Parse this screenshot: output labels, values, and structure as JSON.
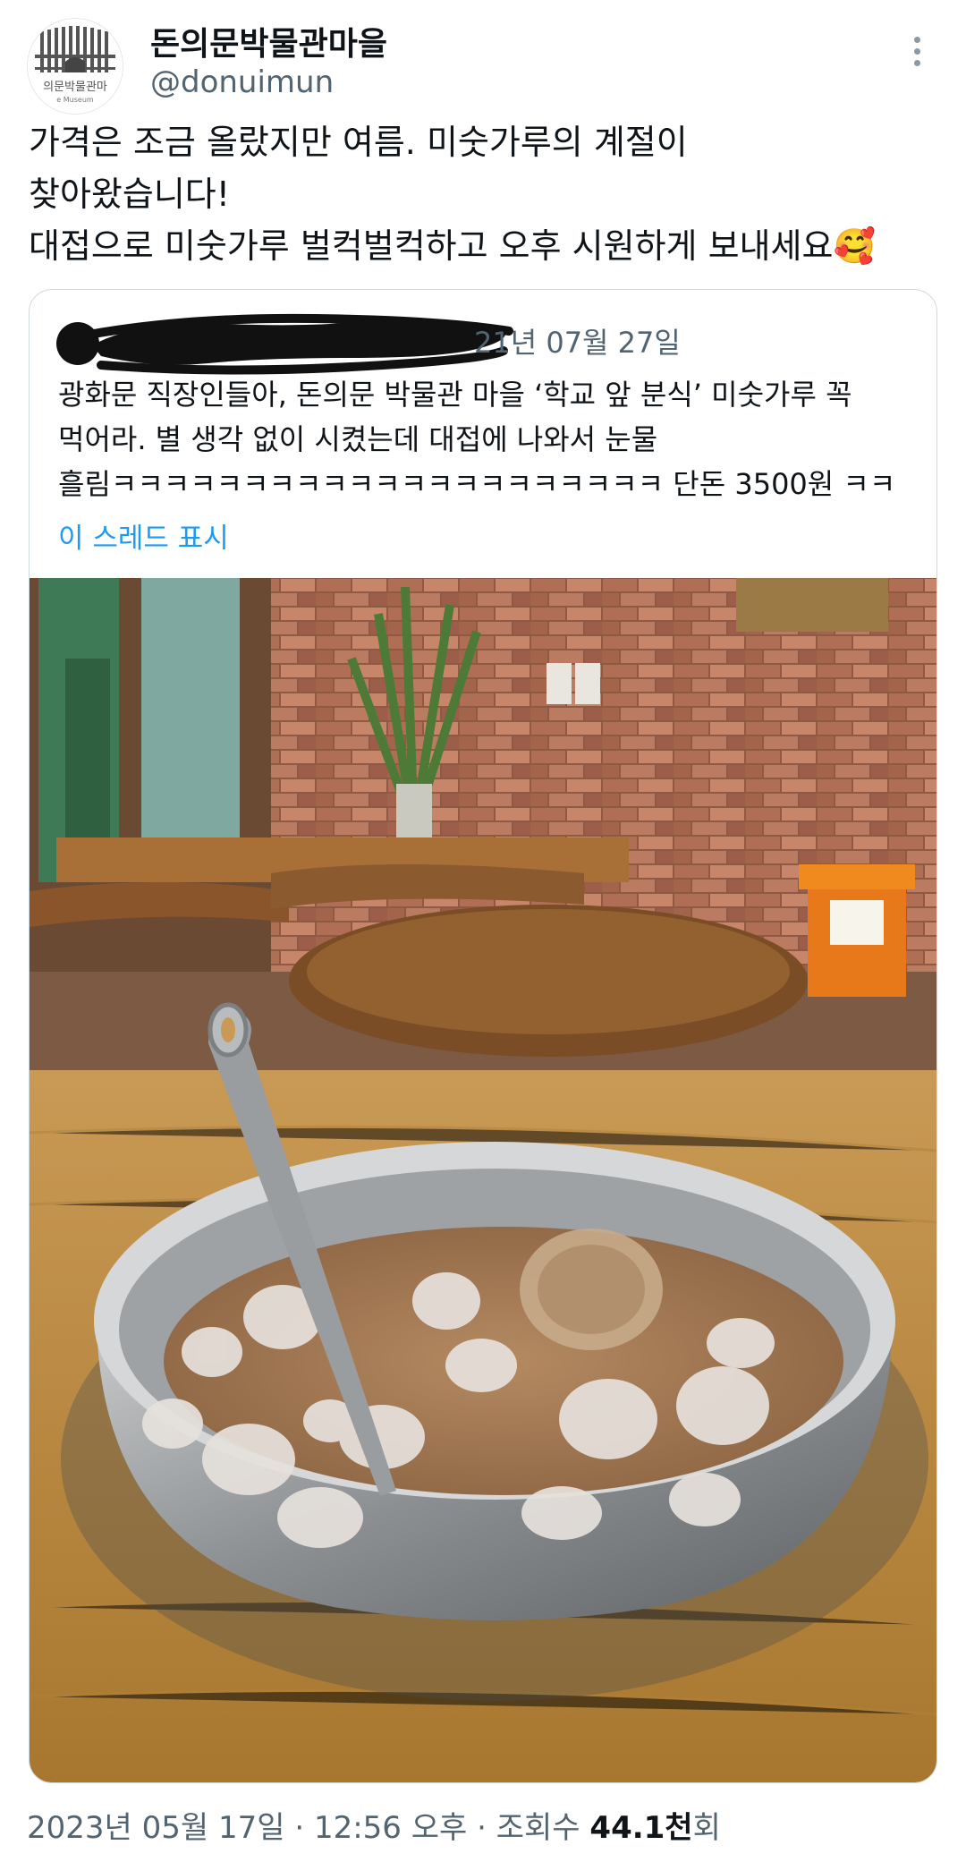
{
  "author": {
    "display_name": "돈의문박물관마을",
    "handle": "@donuimun",
    "avatar_text": "의문박물관마",
    "avatar_subtext": "e Museum"
  },
  "tweet": {
    "lines": [
      "가격은 조금 올랐지만 여름. 미숫가루의 계절이",
      "찾아왔습니다!",
      "대접으로 미숫가루 벌컥벌컥하고 오후 시원하게 보내세요🥰"
    ]
  },
  "quoted": {
    "date": "21년 07월 27일",
    "lines": [
      "광화문 직장인들아, 돈의문 박물관 마을 ‘학교 앞 분식’ 미숫가루 꼭",
      "먹어라. 별 생각 없이 시켰는데 대접에 나와서 눈물",
      "흘림ㅋㅋㅋㅋㅋㅋㅋㅋㅋㅋㅋㅋㅋㅋㅋㅋㅋㅋㅋㅋㅋ 단돈 3500원 ㅋㅋ"
    ],
    "show_thread": "이 스레드 표시"
  },
  "meta": {
    "date": "2023년 05월 17일",
    "sep1": " · ",
    "time": "12:56 오후",
    "sep2": " · ",
    "views_label": "조회수 ",
    "views_count": "44.1천",
    "views_suffix": "회"
  },
  "colors": {
    "text": "#0f1419",
    "secondary": "#536471",
    "link": "#1d9bf0",
    "border": "#cfd9de"
  },
  "icons": {
    "more": "more-vertical-icon"
  }
}
